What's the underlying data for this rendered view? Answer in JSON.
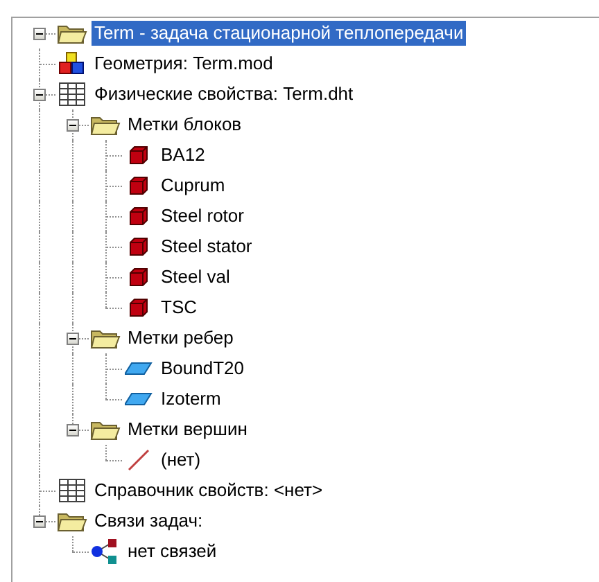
{
  "tree": [
    {
      "label": "Term - задача стационарной теплопередачи",
      "kind": "folder",
      "expanded": true,
      "selected": true,
      "children": [
        {
          "label": "Геометрия: Term.mod",
          "kind": "geometry",
          "selected": false
        },
        {
          "label": "Физические свойства: Term.dht",
          "kind": "table",
          "expanded": true,
          "selected": false,
          "children": [
            {
              "label": "Метки блоков",
              "kind": "folder",
              "expanded": true,
              "selected": false,
              "children": [
                {
                  "label": "BA12",
                  "kind": "block",
                  "selected": false
                },
                {
                  "label": "Cuprum",
                  "kind": "block",
                  "selected": false
                },
                {
                  "label": "Steel rotor",
                  "kind": "block",
                  "selected": false
                },
                {
                  "label": "Steel stator",
                  "kind": "block",
                  "selected": false
                },
                {
                  "label": "Steel val",
                  "kind": "block",
                  "selected": false
                },
                {
                  "label": "TSC",
                  "kind": "block",
                  "selected": false
                }
              ]
            },
            {
              "label": "Метки ребер",
              "kind": "folder",
              "expanded": true,
              "selected": false,
              "children": [
                {
                  "label": "BoundT20",
                  "kind": "edge",
                  "selected": false
                },
                {
                  "label": "Izoterm",
                  "kind": "edge",
                  "selected": false
                }
              ]
            },
            {
              "label": "Метки вершин",
              "kind": "folder",
              "expanded": true,
              "selected": false,
              "children": [
                {
                  "label": "(нет)",
                  "kind": "vertex",
                  "selected": false
                }
              ]
            }
          ]
        },
        {
          "label": "Справочник свойств: <нет>",
          "kind": "table",
          "selected": false
        },
        {
          "label": "Связи задач:",
          "kind": "folder",
          "expanded": true,
          "selected": false,
          "children": [
            {
              "label": "нет связей",
              "kind": "links",
              "selected": false
            }
          ]
        }
      ]
    }
  ]
}
